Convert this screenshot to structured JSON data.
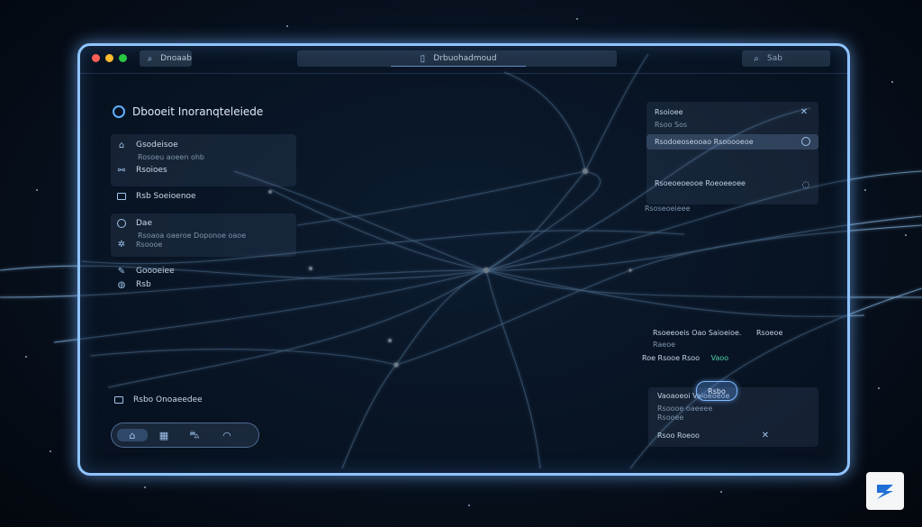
{
  "window": {
    "tab_label": "Dnoaab",
    "address": "Drbuohadmoud",
    "search_placeholder": "Sab"
  },
  "sidebar": {
    "brand": "Dbooeit Inoranqteleiede",
    "items": [
      {
        "label": "Gsodeisoe",
        "sub": "Rosoeu aoeen ohb",
        "icon": "home-icon"
      },
      {
        "label": "Rsoioes",
        "sub": "",
        "icon": "link-icon"
      },
      {
        "label": "Rsb Soeioenoe",
        "sub": "",
        "icon": "monitor-icon"
      },
      {
        "label": "Dae",
        "sub": "Rsoaoa oaeroe Doponoe oaoe",
        "icon": "chat-icon"
      },
      {
        "label": "",
        "sub": "Rsoooe",
        "icon": "sparkle-icon"
      },
      {
        "label": "Goooeiee",
        "sub": "",
        "icon": "pen-icon"
      },
      {
        "label": "Rsb",
        "sub": "",
        "icon": "globe-icon"
      }
    ],
    "footer_label": "Rsbo Onoaeedee"
  },
  "bottom_nav": {
    "items": [
      "home-icon",
      "map-icon",
      "car-icon",
      "profile-icon"
    ]
  },
  "right_panel": {
    "header": "Rsoioee",
    "header_sub": "Rsoo Sos",
    "row1": "Rsodoeoseooao Rsooooeoe",
    "card_text": "Rsoeoeoeooe Roeoeeoee",
    "card_sub": "Rsoseoeieee",
    "stats_line1": "Rsoeeoeis Oao Saioeioe.",
    "stats_line1_extra": "Rsoeoe",
    "stats_line2": "Raeoe",
    "stats_line3": "Roe Rsooe Rsoo",
    "stats_value": "Vaoo",
    "message_title": "Vaoaoeoi Vaioeoeoe",
    "message_sub": "Rsoooe oaeeee",
    "message_sub2": "Rsooee",
    "input_value": "Rsoo Roeoo",
    "send_label": "Rsbo"
  },
  "colors": {
    "frame": "#8fc4ff",
    "accent_green": "#4fd1a6",
    "brand_blue": "#5fb0ff"
  }
}
